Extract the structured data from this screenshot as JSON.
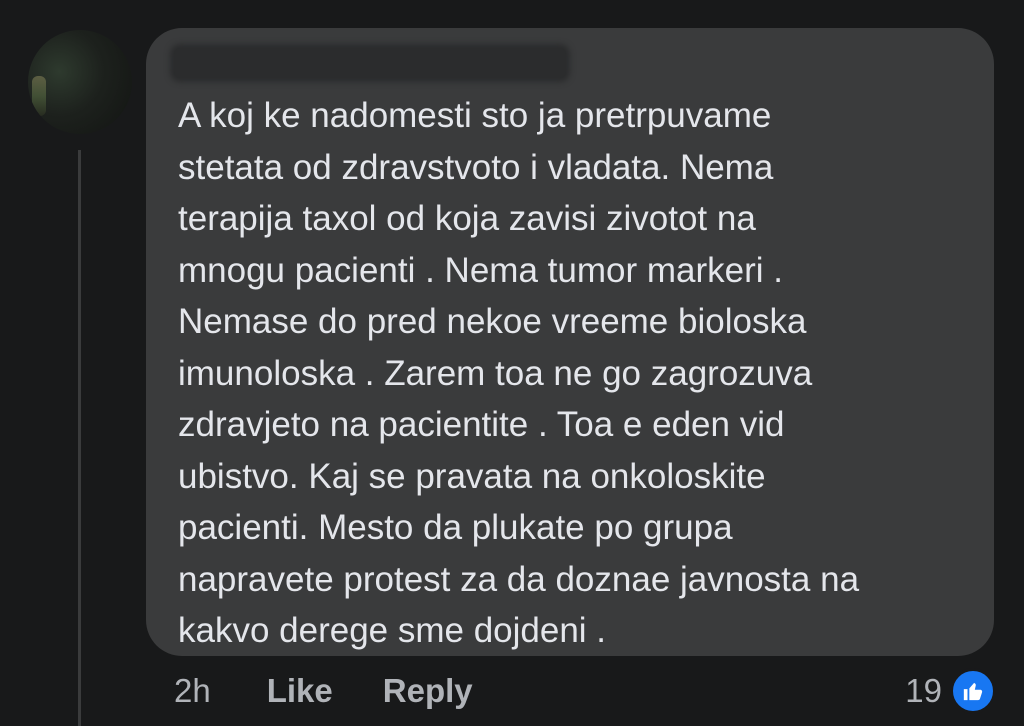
{
  "comment": {
    "author": "",
    "lines": [
      "A koj ke nadomesti sto ja pretrpuvame",
      "stetata od zdravstvoto i vladata. Nema",
      "terapija taxol od koja zavisi zivotot na",
      "mnogu pacienti . Nema tumor markeri .",
      "Nemase do pred nekoe vreeme bioloska",
      "imunoloska . Zarem toa ne go zagrozuva",
      "zdravjeto na pacientite . Toa e eden vid",
      "ubistvo. Kaj se pravata na onkoloskite",
      "pacienti. Mesto da plukate po grupa",
      "napravete protest za da doznae javnosta na",
      "kakvo derege sme dojdeni ."
    ]
  },
  "actions": {
    "time": "2h",
    "like_label": "Like",
    "reply_label": "Reply"
  },
  "reactions": {
    "count": "19",
    "icon": "thumbs-up-icon",
    "icon_color": "#1877f2"
  },
  "colors": {
    "background": "#18191a",
    "bubble": "#3a3b3c",
    "text": "#e4e6eb",
    "secondary_text": "#b0b3b8"
  }
}
